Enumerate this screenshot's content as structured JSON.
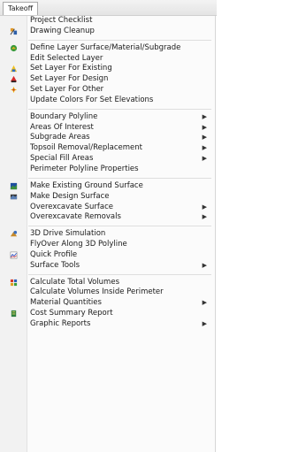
{
  "menubar": {
    "tab_label": "Takeoff"
  },
  "menu": {
    "g1": [
      {
        "label": "Project Checklist"
      },
      {
        "label": "Drawing Cleanup",
        "icon": "drawing-cleanup-icon"
      }
    ],
    "g2": [
      {
        "label": "Define Layer Surface/Material/Subgrade",
        "icon": "define-layer-icon"
      },
      {
        "label": "Edit Selected Layer"
      },
      {
        "label": "Set Layer For Existing",
        "icon": "existing-layer-icon"
      },
      {
        "label": "Set Layer For Design",
        "icon": "design-layer-icon"
      },
      {
        "label": "Set Layer For Other",
        "icon": "other-layer-icon"
      },
      {
        "label": "Update Colors For Set Elevations"
      }
    ],
    "g3": [
      {
        "label": "Boundary Polyline",
        "submenu": true
      },
      {
        "label": "Areas Of Interest",
        "submenu": true
      },
      {
        "label": "Subgrade Areas",
        "submenu": true
      },
      {
        "label": "Topsoil Removal/Replacement",
        "submenu": true
      },
      {
        "label": "Special Fill Areas",
        "submenu": true
      },
      {
        "label": "Perimeter Polyline Properties"
      }
    ],
    "g4": [
      {
        "label": "Make Existing Ground Surface",
        "icon": "existing-surface-icon"
      },
      {
        "label": "Make Design Surface",
        "icon": "design-surface-icon"
      },
      {
        "label": "Overexcavate Surface",
        "submenu": true
      },
      {
        "label": "Overexcavate Removals",
        "submenu": true
      }
    ],
    "g5": [
      {
        "label": "3D Drive Simulation",
        "icon": "drive-simulation-icon"
      },
      {
        "label": "FlyOver Along 3D Polyline"
      },
      {
        "label": "Quick Profile",
        "icon": "quick-profile-icon"
      },
      {
        "label": "Surface Tools",
        "submenu": true
      }
    ],
    "g6": [
      {
        "label": "Calculate Total Volumes",
        "icon": "calculate-volumes-icon"
      },
      {
        "label": "Calculate Volumes Inside Perimeter"
      },
      {
        "label": "Material Quantities",
        "submenu": true
      },
      {
        "label": "Cost Summary Report",
        "icon": "cost-report-icon"
      },
      {
        "label": "Graphic Reports",
        "submenu": true
      }
    ]
  }
}
